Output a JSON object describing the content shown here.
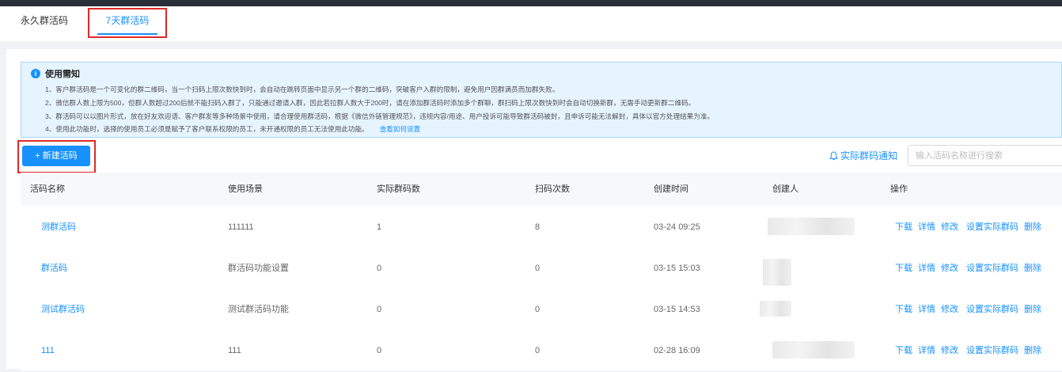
{
  "tabs": [
    {
      "label": "永久群活码"
    },
    {
      "label": "7天群活码"
    }
  ],
  "notice": {
    "title": "使用需知",
    "lines": [
      "1、客户群活码是一个可变化的群二维码，当一个扫码上限次数快到时，会自动在跳转页面中显示另一个群的二维码，突破客户入群的限制，避免用户因群满员而加群失败。",
      "2、微信群人数上限为500，但群人数超过200后就不能扫码入群了，只能通过邀请入群，因此若拉群人数大于200时，请在添加群活码时添加多个群聊，群扫码上限次数快到时会自动切换新群，无需手动更新群二维码。",
      "3、群活码可以以图片形式，放在好友欢迎语、客户群发等多种场景中使用，请合理使用群活码，根据《微信外链管理规范》，违规内容/用途、用户投诉可能导致群活码被封，且申诉可能无法解封，具体以官方处理结果为准。",
      "4、使用此功能时，选择的使用员工必须是赋予了客户联系权限的员工，未开通权限的员工无法使用此功能。"
    ],
    "link": "查看如何设置"
  },
  "toolbar": {
    "new_button": "新建活码",
    "notify_label": "实际群码通知",
    "search_placeholder": "输入活码名称进行搜索"
  },
  "table": {
    "headers": [
      "活码名称",
      "使用场景",
      "实际群码数",
      "扫码次数",
      "创建时间",
      "创建人",
      "操作"
    ],
    "rows": [
      {
        "name": "测群活码",
        "scene": "111111",
        "count": "1",
        "scans": "8",
        "time": "03-24 09:25"
      },
      {
        "name": "群活码",
        "scene": "群活码功能设置",
        "count": "0",
        "scans": "0",
        "time": "03-15 15:03"
      },
      {
        "name": "测试群活码",
        "scene": "测试群活码功能",
        "count": "0",
        "scans": "0",
        "time": "03-15 14:53"
      },
      {
        "name": "111",
        "scene": "111",
        "count": "0",
        "scans": "0",
        "time": "02-28 16:09"
      }
    ],
    "actions": [
      "下载",
      "详情",
      "修改",
      "设置实际群码",
      "删除"
    ]
  }
}
